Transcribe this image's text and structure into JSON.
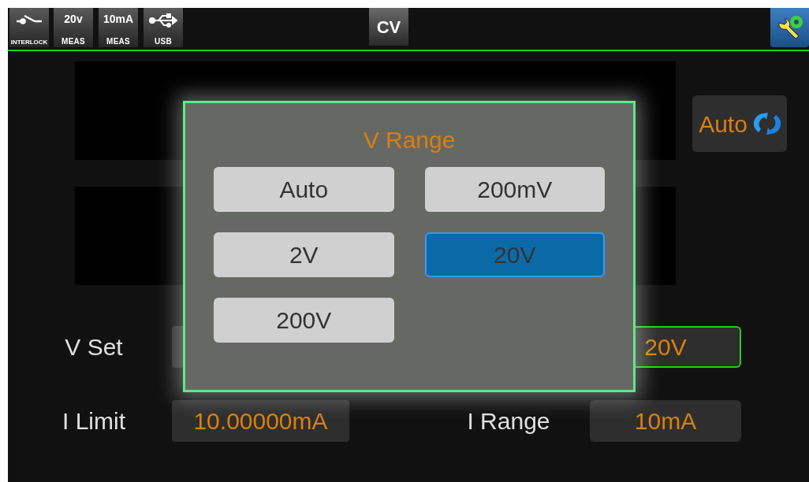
{
  "status_bar": {
    "indicators": [
      {
        "kind": "interlock",
        "label": "INTERLOCK"
      },
      {
        "kind": "meas",
        "value": "20v",
        "label": "MEAS"
      },
      {
        "kind": "meas",
        "value": "10mA",
        "label": "MEAS"
      },
      {
        "kind": "usb",
        "label": "USB"
      }
    ],
    "mode": "CV"
  },
  "range_button": {
    "label": "Auto"
  },
  "settings": [
    {
      "label": "V Set",
      "range_focused": true,
      "range_value": "20V"
    },
    {
      "label": "I Limit",
      "value": "10.00000mA",
      "range_label": "I Range",
      "range_value": "10mA",
      "range_focused": false
    }
  ],
  "dialog": {
    "title": "V Range",
    "options": [
      {
        "label": "Auto",
        "selected": false
      },
      {
        "label": "200mV",
        "selected": false
      },
      {
        "label": "2V",
        "selected": false
      },
      {
        "label": "20V",
        "selected": true
      },
      {
        "label": "200V",
        "selected": false
      }
    ]
  }
}
